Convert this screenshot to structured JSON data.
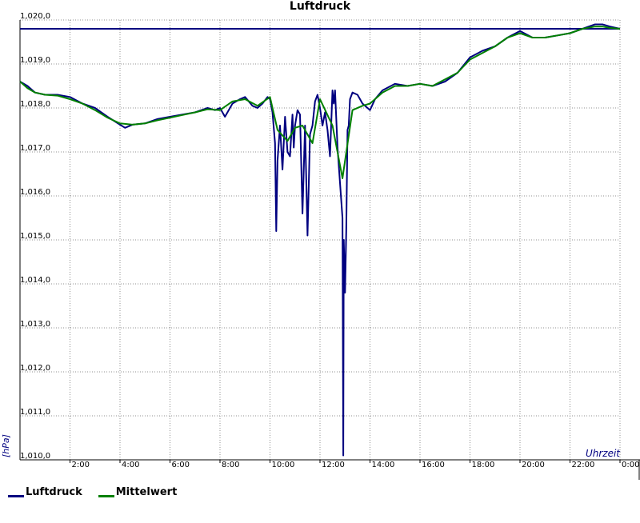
{
  "chart_data": {
    "type": "line",
    "title": "Luftdruck",
    "xlabel": "Uhrzeit",
    "ylabel": "[hPa]",
    "xlim": [
      0,
      24
    ],
    "ylim": [
      1010.0,
      1020.0
    ],
    "x_ticks": [
      2,
      4,
      6,
      8,
      10,
      12,
      14,
      16,
      18,
      20,
      22,
      24
    ],
    "x_tick_labels": [
      "2:00",
      "4:00",
      "6:00",
      "8:00",
      "10:00",
      "12:00",
      "14:00",
      "16:00",
      "18:00",
      "20:00",
      "22:00",
      "0:00"
    ],
    "y_ticks": [
      1010.0,
      1011.0,
      1012.0,
      1013.0,
      1014.0,
      1015.0,
      1016.0,
      1017.0,
      1018.0,
      1019.0,
      1020.0
    ],
    "y_tick_labels": [
      "1,010,0",
      "1,011,0",
      "1,012,0",
      "1,013,0",
      "1,014,0",
      "1,015,0",
      "1,016,0",
      "1,017,0",
      "1,018,0",
      "1,019,0",
      "1,020,0"
    ],
    "grid": true,
    "legend_position": "bottom-left",
    "reference_line": {
      "y": 1019.8,
      "color": "#000080"
    },
    "series": [
      {
        "name": "Luftdruck",
        "color": "#000080",
        "x": [
          0,
          0.3,
          0.6,
          1.0,
          1.5,
          2.0,
          2.5,
          3.0,
          3.5,
          4.0,
          4.2,
          4.5,
          5.0,
          5.5,
          6.0,
          6.5,
          7.0,
          7.5,
          7.8,
          8.0,
          8.2,
          8.5,
          8.8,
          9.0,
          9.3,
          9.5,
          9.7,
          9.9,
          10.0,
          10.1,
          10.2,
          10.25,
          10.3,
          10.4,
          10.5,
          10.6,
          10.7,
          10.8,
          10.9,
          10.95,
          11.0,
          11.1,
          11.2,
          11.3,
          11.4,
          11.5,
          11.6,
          11.7,
          11.8,
          11.9,
          12.0,
          12.1,
          12.2,
          12.3,
          12.4,
          12.5,
          12.55,
          12.6,
          12.7,
          12.8,
          12.9,
          12.93,
          12.95,
          13.0,
          13.05,
          13.1,
          13.15,
          13.2,
          13.3,
          13.5,
          13.7,
          13.9,
          14.0,
          14.2,
          14.5,
          15.0,
          15.5,
          16.0,
          16.5,
          17.0,
          17.5,
          18.0,
          18.5,
          19.0,
          19.5,
          20.0,
          20.5,
          21.0,
          21.5,
          22.0,
          22.5,
          23.0,
          23.3,
          23.6,
          24.0
        ],
        "values": [
          1018.6,
          1018.5,
          1018.35,
          1018.3,
          1018.3,
          1018.25,
          1018.1,
          1018.0,
          1017.8,
          1017.62,
          1017.55,
          1017.62,
          1017.65,
          1017.75,
          1017.8,
          1017.85,
          1017.9,
          1018.0,
          1017.95,
          1018.0,
          1017.8,
          1018.1,
          1018.2,
          1018.25,
          1018.05,
          1018.0,
          1018.1,
          1018.25,
          1018.2,
          1017.9,
          1017.2,
          1015.2,
          1016.8,
          1017.6,
          1016.6,
          1017.8,
          1017.0,
          1016.9,
          1017.85,
          1017.1,
          1017.6,
          1017.95,
          1017.85,
          1015.6,
          1017.6,
          1015.1,
          1017.4,
          1017.6,
          1018.15,
          1018.3,
          1018.0,
          1017.6,
          1017.9,
          1017.5,
          1016.9,
          1018.4,
          1018.1,
          1018.4,
          1017.1,
          1016.3,
          1015.5,
          1010.1,
          1015.0,
          1013.8,
          1015.2,
          1017.5,
          1017.6,
          1018.2,
          1018.35,
          1018.3,
          1018.1,
          1018.0,
          1017.95,
          1018.2,
          1018.4,
          1018.55,
          1018.5,
          1018.55,
          1018.5,
          1018.6,
          1018.8,
          1019.15,
          1019.3,
          1019.4,
          1019.6,
          1019.75,
          1019.6,
          1019.6,
          1019.65,
          1019.7,
          1019.8,
          1019.9,
          1019.9,
          1019.85,
          1019.8
        ]
      },
      {
        "name": "Mittelwert",
        "color": "#008000",
        "x": [
          0,
          0.3,
          0.6,
          1.0,
          1.5,
          2.0,
          2.5,
          3.0,
          3.5,
          4.0,
          4.5,
          5.0,
          5.5,
          6.0,
          6.5,
          7.0,
          7.5,
          8.0,
          8.5,
          9.0,
          9.5,
          10.0,
          10.3,
          10.7,
          11.0,
          11.3,
          11.7,
          12.0,
          12.5,
          12.9,
          13.0,
          13.3,
          13.7,
          14.0,
          14.5,
          15.0,
          15.5,
          16.0,
          16.5,
          17.0,
          17.5,
          18.0,
          18.5,
          19.0,
          19.5,
          20.0,
          20.5,
          21.0,
          21.5,
          22.0,
          22.5,
          23.0,
          23.3,
          23.6,
          24.0
        ],
        "values": [
          1018.6,
          1018.45,
          1018.35,
          1018.3,
          1018.28,
          1018.2,
          1018.1,
          1017.95,
          1017.78,
          1017.65,
          1017.62,
          1017.65,
          1017.72,
          1017.78,
          1017.84,
          1017.9,
          1017.97,
          1017.95,
          1018.15,
          1018.2,
          1018.05,
          1018.25,
          1017.5,
          1017.25,
          1017.55,
          1017.6,
          1017.2,
          1018.2,
          1017.6,
          1016.4,
          1016.8,
          1017.95,
          1018.05,
          1018.1,
          1018.35,
          1018.5,
          1018.5,
          1018.55,
          1018.5,
          1018.65,
          1018.8,
          1019.1,
          1019.25,
          1019.4,
          1019.6,
          1019.7,
          1019.6,
          1019.6,
          1019.65,
          1019.7,
          1019.8,
          1019.85,
          1019.85,
          1019.82,
          1019.8
        ]
      }
    ]
  }
}
